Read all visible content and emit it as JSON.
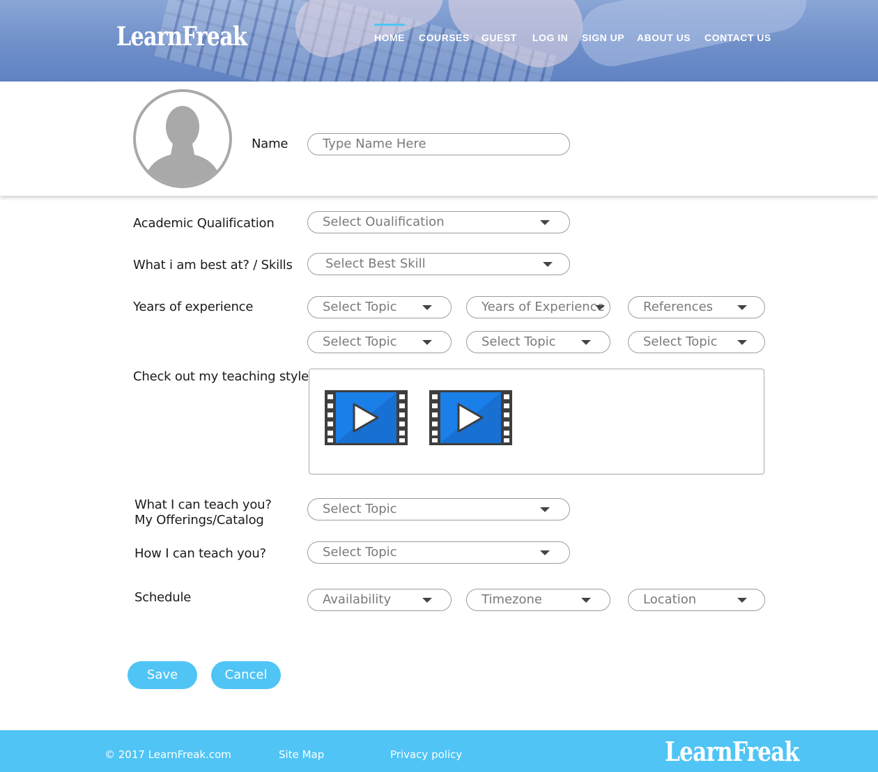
{
  "brand": {
    "logo_text": "LearnFreak"
  },
  "nav": {
    "items": [
      {
        "label": "HOME",
        "active": true
      },
      {
        "label": "COURSES"
      },
      {
        "label": "GUEST"
      },
      {
        "label": "LOG IN"
      },
      {
        "label": "SIGN UP"
      },
      {
        "label": "ABOUT US"
      },
      {
        "label": "CONTACT US"
      }
    ]
  },
  "profile": {
    "avatar_icon": "user-silhouette-icon",
    "name_label": "Name",
    "name_placeholder": "Type Name Here"
  },
  "form": {
    "qualification": {
      "label": "Academic Qualification",
      "value": "Select Oualification"
    },
    "skills": {
      "label": "What i am best at? / Skills",
      "value": "Select Best Skill"
    },
    "experience": {
      "label": "Years of experience",
      "row1": [
        "Select Topic",
        "Years of Experience",
        "References"
      ],
      "row2": [
        "Select Topic",
        "Select Topic",
        "Select Topic"
      ]
    },
    "teaching_style": {
      "label": "Check out my teaching style",
      "video_icon": "video-play-icon"
    },
    "offerings": {
      "label_line1": "What I can teach you?",
      "label_line2": "My Offerings/Catalog",
      "value": "Select Topic"
    },
    "how": {
      "label": "How I can teach you?",
      "value": "Select Topic"
    },
    "schedule": {
      "label": "Schedule",
      "fields": [
        "Availability",
        "Timezone",
        "Location"
      ]
    }
  },
  "actions": {
    "save": "Save",
    "cancel": "Cancel"
  },
  "footer": {
    "copyright": "© 2017 LearnFreak.com",
    "sitemap": "Site Map",
    "privacy": "Privacy policy",
    "logo_text": "LearnFreak"
  },
  "colors": {
    "accent": "#4fc4f5",
    "header": "#6f8fc9",
    "video_blue": "#1a7fe8"
  }
}
